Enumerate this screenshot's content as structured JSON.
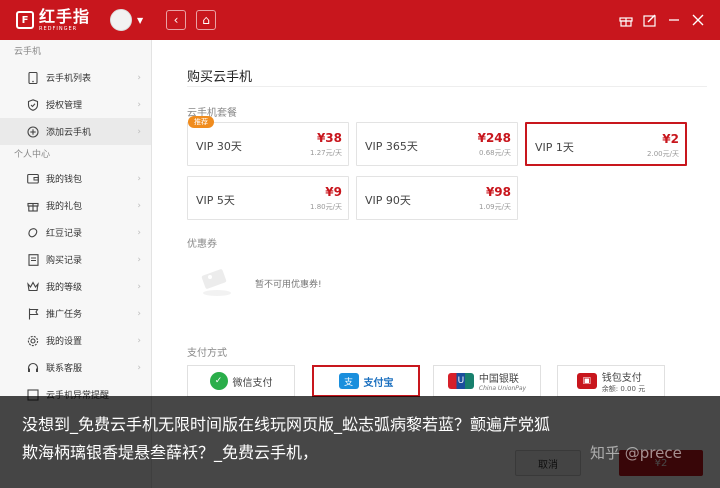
{
  "app": {
    "logo_mark": "F",
    "logo_name": "红手指",
    "logo_sub": "REDFINGER"
  },
  "titlebar": {
    "back_icon": "‹",
    "home_icon": "⌂",
    "icons": [
      "gift-icon",
      "edit-icon",
      "minimize-icon",
      "close-icon"
    ]
  },
  "sidebar": {
    "section1": "云手机",
    "items1": [
      {
        "label": "云手机列表"
      },
      {
        "label": "授权管理"
      },
      {
        "label": "添加云手机"
      }
    ],
    "section2": "个人中心",
    "items2": [
      {
        "label": "我的钱包"
      },
      {
        "label": "我的礼包"
      },
      {
        "label": "红豆记录"
      },
      {
        "label": "购买记录"
      },
      {
        "label": "我的等级"
      },
      {
        "label": "推广任务"
      },
      {
        "label": "我的设置"
      },
      {
        "label": "联系客服"
      },
      {
        "label": "云手机异常提醒"
      }
    ]
  },
  "main": {
    "title": "购买云手机",
    "packages_label": "云手机套餐",
    "packages": [
      {
        "name": "VIP 30天",
        "price": "¥38",
        "daily": "1.27元/天",
        "badge": "推荐"
      },
      {
        "name": "VIP 365天",
        "price": "¥248",
        "daily": "0.68元/天"
      },
      {
        "name": "VIP 1天",
        "price": "¥2",
        "daily": "2.00元/天"
      },
      {
        "name": "VIP 5天",
        "price": "¥9",
        "daily": "1.80元/天"
      },
      {
        "name": "VIP 90天",
        "price": "¥98",
        "daily": "1.09元/天"
      }
    ],
    "selected_package": "VIP 1天",
    "coupon_label": "优惠券",
    "coupon_empty": "暂不可用优惠券!",
    "payment_label": "支付方式",
    "payments": [
      {
        "name": "微信支付",
        "logo": "✓"
      },
      {
        "name": "支付宝",
        "logo": "支"
      },
      {
        "name": "中国银联",
        "sub": "China UnionPay",
        "logo": "U"
      },
      {
        "name": "钱包支付",
        "balance": "余额: 0.00 元",
        "logo": "▣"
      }
    ],
    "selected_payment": "支付宝",
    "cancel": "取消",
    "amount_prefix": "¥2"
  },
  "caption": {
    "line1": "没想到_免费云手机无限时间版在线玩网页版_蚣志弧病黎若蓝？颤遍芹党狐",
    "line2": "欺海柄璃银香堤悬叁薛袄？_免费云手机，"
  },
  "watermark": "知乎 @prece",
  "colors": {
    "brand_red": "#c8161d",
    "badge_orange": "#f08c1e"
  }
}
